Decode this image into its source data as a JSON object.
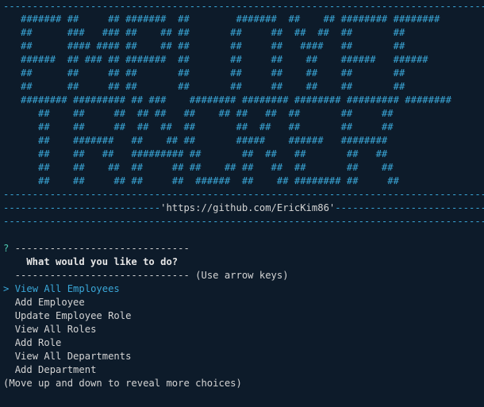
{
  "colors": {
    "background": "#0d1b2a",
    "accent": "#3aa7d8",
    "prompt_marker": "#4ec9b0",
    "text": "#d4d4d4"
  },
  "banner": {
    "top_rule": "-----------------------------------------------------------------------------------",
    "art": [
      "   ####### ##     ## #######  ##        #######  ##    ## ######## ########",
      "   ##      ###   ### ##    ## ##       ##     ##  ##  ##  ##       ##",
      "   ##      #### #### ##    ## ##       ##     ##   ####   ##       ##",
      "   ######  ## ### ## #######  ##       ##     ##    ##    ######   ######",
      "   ##      ##     ## ##       ##       ##     ##    ##    ##       ##",
      "   ##      ##     ## ##       ##       ##     ##    ##    ##       ##",
      "   ######## ######### ## ###    ######## ######## ######## ######### ########",
      "      ##    ##     ##  ## ##   ##    ## ##   ##  ##       ##     ##",
      "      ##    ##     ##  ##  ##  ##       ##  ##   ##       ##     ##",
      "      ##    #######   ##    ## ##       #####    ######   ########",
      "      ##    ##   ##   ######### ##       ##  ##   ##       ##   ##",
      "      ##    ##    ##  ##     ## ##    ## ##   ##  ##       ##    ##",
      "      ##    ##     ## ##     ##  ######  ##    ## ######## ##     ##"
    ],
    "mid_rule": "-----------------------------------------------------------------------------------",
    "link_rule_left": "---------------------------",
    "link_text": "'https://github.com/EricKim86'",
    "link_rule_right": "---------------------------",
    "bottom_rule": "-----------------------------------------------------------------------------------"
  },
  "prompt": {
    "marker": "?",
    "rule_top": " ------------------------------",
    "question": "    What would you like to do?",
    "rule_bottom": "  ------------------------------",
    "hint": " (Use arrow keys)"
  },
  "menu": {
    "pointer": "> ",
    "items": [
      {
        "label": "View All Employees",
        "selected": true
      },
      {
        "label": "Add Employee",
        "selected": false
      },
      {
        "label": "Update Employee Role",
        "selected": false
      },
      {
        "label": "View All Roles",
        "selected": false
      },
      {
        "label": "Add Role",
        "selected": false
      },
      {
        "label": "View All Departments",
        "selected": false
      },
      {
        "label": "Add Department",
        "selected": false
      }
    ],
    "footer": "(Move up and down to reveal more choices)"
  }
}
